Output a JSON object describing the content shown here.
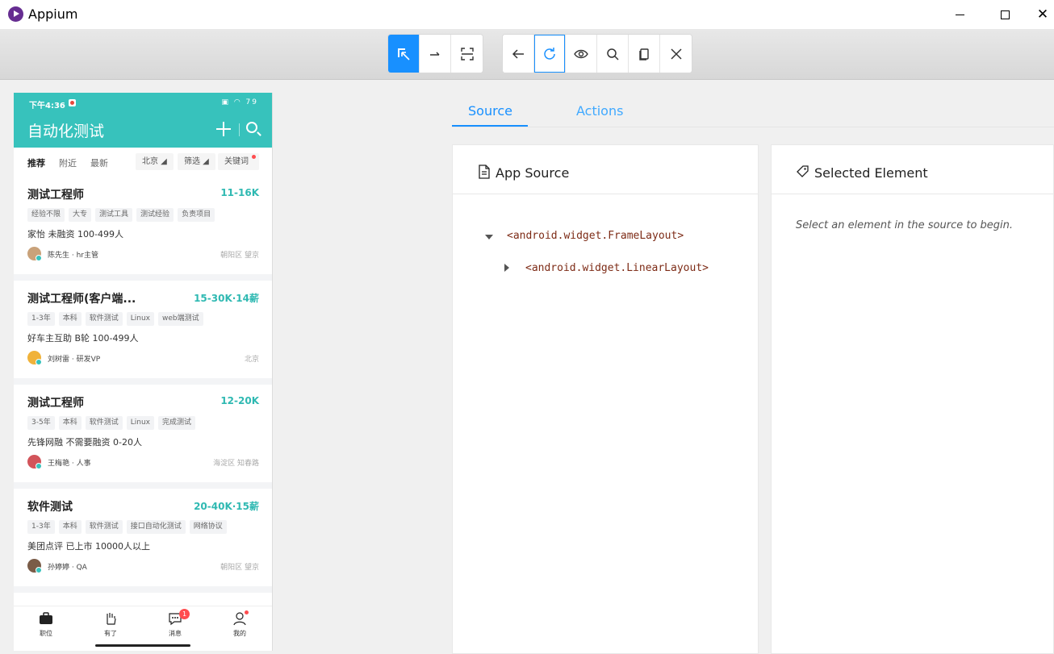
{
  "window": {
    "title": "Appium"
  },
  "toolbar": {
    "group1": [
      "select-elements-icon",
      "swipe-icon",
      "tap-by-coordinates-icon"
    ],
    "group2": [
      "back-icon",
      "refresh-icon",
      "eye-icon",
      "search-icon",
      "copy-xml-icon",
      "quit-session-icon"
    ],
    "accent": "#1890ff"
  },
  "phone": {
    "status_time": "下午4:36",
    "status_battery": "79",
    "header_title": "自动化测试",
    "header_color": "#37c2bc",
    "filter_tabs": [
      "推荐",
      "附近",
      "最新"
    ],
    "filter_chips": [
      "北京",
      "筛选",
      "关键词"
    ],
    "jobs": [
      {
        "title": "测试工程师",
        "salary": "11-16K",
        "tags": [
          "经验不限",
          "大专",
          "测试工具",
          "测试经验",
          "负责项目"
        ],
        "company": "家怡  未融资  100-499人",
        "recruiter": "陈先生 · hr主管",
        "location": "朝阳区  望京"
      },
      {
        "title": "测试工程师(客户端...",
        "salary": "15-30K·14薪",
        "tags": [
          "1-3年",
          "本科",
          "软件测试",
          "Linux",
          "web端测试"
        ],
        "company": "好车主互助  B轮  100-499人",
        "recruiter": "刘树雷 · 研发VP",
        "location": "北京"
      },
      {
        "title": "测试工程师",
        "salary": "12-20K",
        "tags": [
          "3-5年",
          "本科",
          "软件测试",
          "Linux",
          "完成测试"
        ],
        "company": "先锋网融  不需要融资  0-20人",
        "recruiter": "王梅艳 · 人事",
        "location": "海淀区  知春路"
      },
      {
        "title": "软件测试",
        "salary": "20-40K·15薪",
        "tags": [
          "1-3年",
          "本科",
          "软件测试",
          "接口自动化测试",
          "网络协议"
        ],
        "company": "美团点评  已上市  10000人以上",
        "recruiter": "孙婷婷 · QA",
        "location": "朝阳区  望京"
      }
    ],
    "nav": [
      {
        "label": "职位",
        "icon": "briefcase-icon"
      },
      {
        "label": "有了",
        "icon": "hand-icon"
      },
      {
        "label": "消息",
        "icon": "message-icon",
        "badge": "1"
      },
      {
        "label": "我的",
        "icon": "user-icon"
      }
    ]
  },
  "inspector": {
    "tabs": [
      "Source",
      "Actions"
    ],
    "app_source_title": "App Source",
    "tree": [
      "<android.widget.FrameLayout>",
      "<android.widget.LinearLayout>"
    ],
    "selected_title": "Selected Element",
    "selected_hint": "Select an element in the source to begin."
  }
}
